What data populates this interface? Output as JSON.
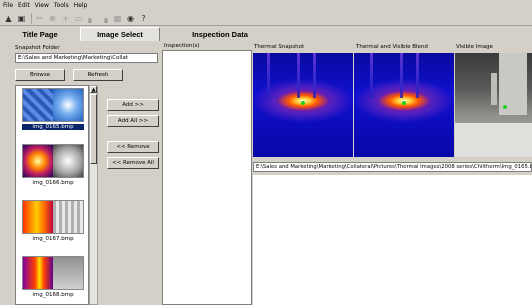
{
  "menu": [
    "File",
    "Edit",
    "View",
    "Tools",
    "Help"
  ],
  "toolbar": [
    "open-icon",
    "save-icon",
    "cut-icon",
    "crosshair-icon",
    "plus-icon",
    "rect-icon",
    "histogram-icon",
    "histogram-icon",
    "palette-icon",
    "camera-icon",
    "help-icon"
  ],
  "tabs": {
    "title_page": "Title Page",
    "image_select": "Image Select",
    "inspection_data": "Inspection Data"
  },
  "snapshot_folder": {
    "label": "Snapshot Folder",
    "path": "E:\\Sales and Marketing\\Marketing\\Collat"
  },
  "buttons": {
    "browse": "Browse",
    "refresh": "Refresh",
    "add": "Add >>",
    "add_all": "Add All >>",
    "remove": "<< Remove",
    "remove_all": "<< Remove All"
  },
  "thumbnails": [
    "img_0165.bmp",
    "img_0166.bmp",
    "img_0167.bmp",
    "img_0168.bmp"
  ],
  "inspection_list": {
    "label": "Inspection(s)"
  },
  "views": {
    "thermal": "Thermal Snapshot",
    "blend": "Thermal and Visible Blend",
    "visible": "Visible Image"
  },
  "image_path": "E:\\Sales and Marketing\\Marketing\\Collateral\\Pictures\\Thermal Images\\2008 series\\Chiltherm\\Img_0165.bmp",
  "colors": {
    "selection": "#0a246a",
    "face": "#d4d0c8"
  }
}
